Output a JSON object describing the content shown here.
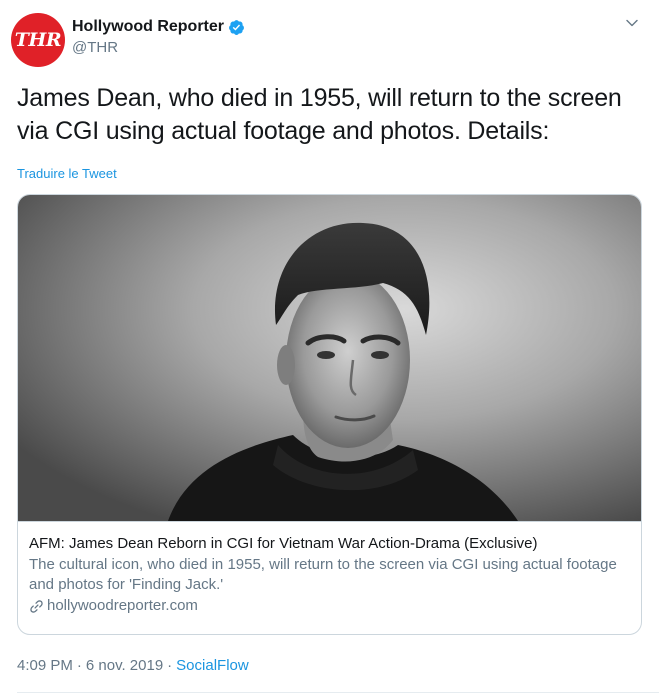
{
  "author": {
    "avatar_text": "THR",
    "display_name": "Hollywood Reporter",
    "handle": "@THR",
    "verified": true
  },
  "tweet": {
    "text": "James Dean, who died in 1955, will return to the screen via CGI using actual footage and photos. Details:",
    "translate_label": "Traduire le Tweet"
  },
  "card": {
    "image_icon": "portrait-photo",
    "title": "AFM: James Dean Reborn in CGI for Vietnam War Action-Drama (Exclusive)",
    "description": "The cultural icon, who died in 1955, will return to the screen via CGI using actual footage and photos for 'Finding Jack.'",
    "domain": "hollywoodreporter.com"
  },
  "meta": {
    "time": "4:09 PM",
    "date": "6 nov. 2019",
    "separator": "·",
    "source": "SocialFlow"
  },
  "colors": {
    "brand_red": "#e02128",
    "link_blue": "#1b95e0",
    "verified_blue": "#1da1f2",
    "secondary_gray": "#657786",
    "border": "#ccd6dd"
  }
}
